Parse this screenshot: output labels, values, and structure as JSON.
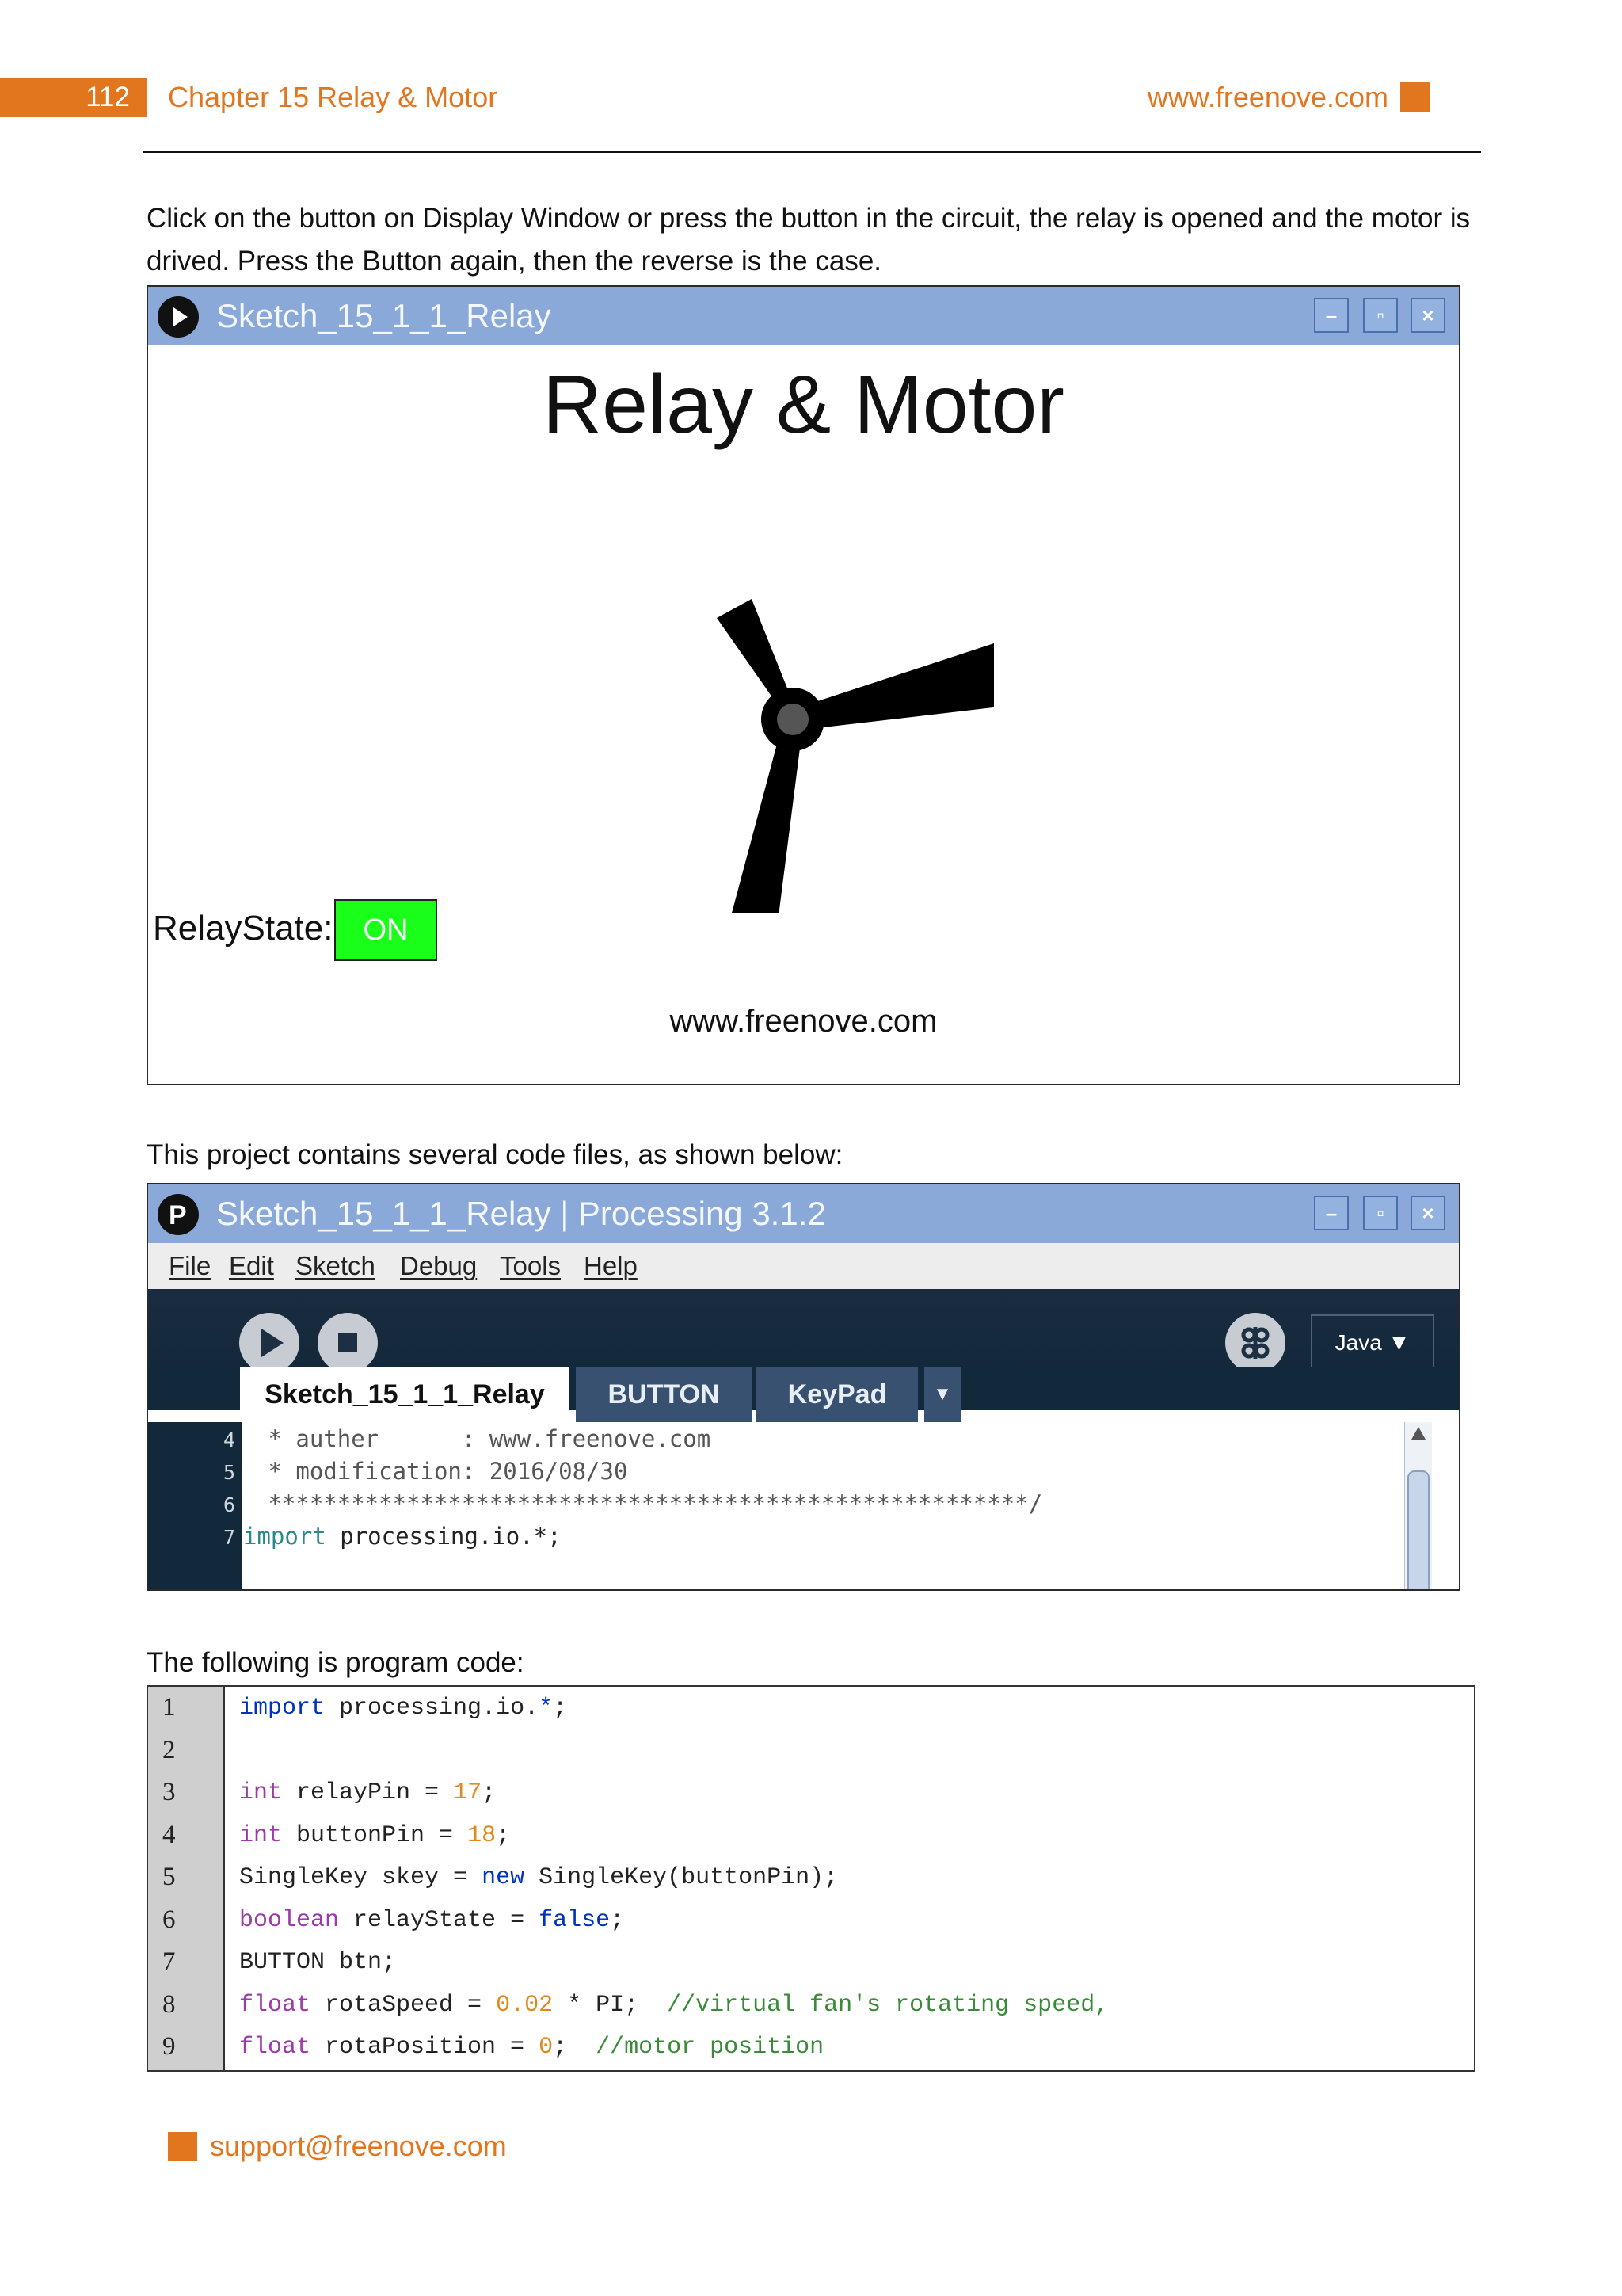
{
  "header": {
    "page_number": "112",
    "chapter": "Chapter 15 Relay & Motor",
    "website": "www.freenove.com"
  },
  "intro_text": "Click on the button on Display Window or press the button in the circuit, the relay is opened and the motor is drived. Press the Button again, then the reverse is the case.",
  "sketch_window": {
    "title": "Sketch_15_1_1_Relay",
    "heading": "Relay & Motor",
    "relay_label": "RelayState:",
    "relay_button": "ON",
    "footer_url": "www.freenove.com",
    "colors": {
      "titlebar": "#8aa9d8",
      "on_button": "#1aff1a"
    }
  },
  "files_text": "This project contains several code files, as shown below:",
  "ide_window": {
    "title": "Sketch_15_1_1_Relay | Processing 3.1.2",
    "menu": [
      "File",
      "Edit",
      "Sketch",
      "Debug",
      "Tools",
      "Help"
    ],
    "mode": "Java ▼",
    "tabs": [
      "Sketch_15_1_1_Relay",
      "BUTTON",
      "KeyPad"
    ],
    "tab_dropdown": "▼",
    "lines": [
      {
        "num": "4",
        "text": " * auther      : www.freenove.com"
      },
      {
        "num": "5",
        "text": " * modification: 2016/08/30"
      },
      {
        "num": "6",
        "text": " *******************************************************/"
      },
      {
        "num": "7",
        "text_kw": "import",
        "text_rest": " processing.io.*;"
      }
    ],
    "icons": [
      "play-icon",
      "stop-icon",
      "debug-icon"
    ]
  },
  "program_text": "The following is program code:",
  "code": {
    "line_numbers": [
      "1",
      "2",
      "3",
      "4",
      "5",
      "6",
      "7",
      "8",
      "9"
    ],
    "lines": [
      [
        [
          "kw",
          "import"
        ],
        [
          "",
          " processing.io."
        ],
        [
          "kw",
          "*"
        ],
        [
          "",
          ";"
        ]
      ],
      [],
      [
        [
          "ty",
          "int"
        ],
        [
          "",
          " relayPin = "
        ],
        [
          "nm",
          "17"
        ],
        [
          "",
          ";"
        ]
      ],
      [
        [
          "ty",
          "int"
        ],
        [
          "",
          " buttonPin = "
        ],
        [
          "nm",
          "18"
        ],
        [
          "",
          ";"
        ]
      ],
      [
        [
          "",
          "SingleKey skey = "
        ],
        [
          "kw",
          "new"
        ],
        [
          "",
          " SingleKey(buttonPin);"
        ]
      ],
      [
        [
          "ty",
          "boolean"
        ],
        [
          "",
          " relayState = "
        ],
        [
          "kw",
          "false"
        ],
        [
          "",
          ";"
        ]
      ],
      [
        [
          "",
          "BUTTON btn;"
        ]
      ],
      [
        [
          "ty",
          "float"
        ],
        [
          "",
          " rotaSpeed = "
        ],
        [
          "nm",
          "0.02"
        ],
        [
          "",
          " * PI;  "
        ],
        [
          "cm",
          "//virtual fan's rotating speed,"
        ]
      ],
      [
        [
          "ty",
          "float"
        ],
        [
          "",
          " rotaPosition = "
        ],
        [
          "nm",
          "0"
        ],
        [
          "",
          ";  "
        ],
        [
          "cm",
          "//motor position"
        ]
      ]
    ]
  },
  "footer": {
    "email": "support@freenove.com"
  }
}
